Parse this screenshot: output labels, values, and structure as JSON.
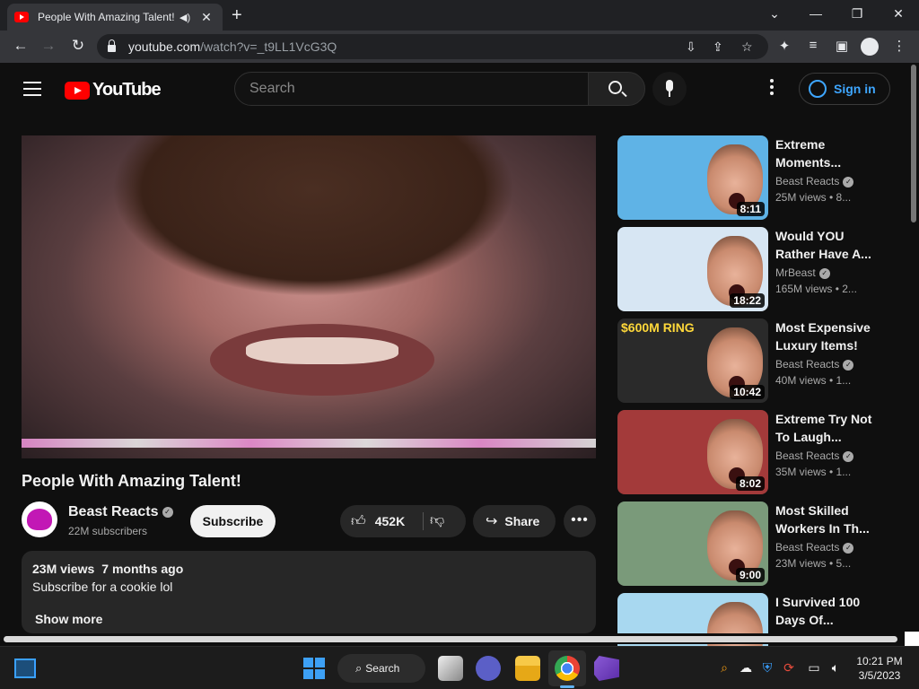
{
  "browser": {
    "tab_title": "People With Amazing Talent!",
    "speaker_icon": "speaker-icon",
    "close_glyph": "✕",
    "new_tab_glyph": "+",
    "window_controls": [
      "⌄",
      "—",
      "❐",
      "✕"
    ],
    "url_host": "youtube.com",
    "url_path": "/watch?v=_t9LL1VcG3Q"
  },
  "youtube": {
    "logo_text": "YouTube",
    "search_placeholder": "Search",
    "sign_in": "Sign in",
    "accent": "#3ea6ff",
    "brand_red": "#ff0000"
  },
  "video": {
    "title": "People With Amazing Talent!",
    "channel": "Beast Reacts",
    "subscribers": "22M subscribers",
    "subscribe_label": "Subscribe",
    "likes": "452K",
    "share_label": "Share",
    "more_glyph": "•••",
    "views": "23M views",
    "age": "7 months ago",
    "description": "Subscribe for a cookie lol",
    "show_more": "Show more"
  },
  "recommendations": [
    {
      "title": "Extreme Moments...",
      "channel": "Beast Reacts",
      "meta": "25M views • 8...",
      "duration": "8:11",
      "verified": true,
      "bg": "#5fb3e6"
    },
    {
      "title": "Would YOU Rather Have A...",
      "channel": "MrBeast",
      "meta": "165M views • 2...",
      "duration": "18:22",
      "verified": true,
      "bg": "#d7e6f3"
    },
    {
      "title": "Most Expensive Luxury Items!",
      "channel": "Beast Reacts",
      "meta": "40M views • 1...",
      "duration": "10:42",
      "verified": true,
      "bg": "#2a2a2a",
      "overlay": "$600M RING"
    },
    {
      "title": "Extreme Try Not To Laugh...",
      "channel": "Beast Reacts",
      "meta": "35M views • 1...",
      "duration": "8:02",
      "verified": true,
      "bg": "#a33a3a"
    },
    {
      "title": "Most Skilled Workers In Th...",
      "channel": "Beast Reacts",
      "meta": "23M views • 5...",
      "duration": "9:00",
      "verified": true,
      "bg": "#7a9a7a"
    },
    {
      "title": "I Survived 100 Days Of...",
      "channel": "",
      "meta": "",
      "duration": "",
      "verified": false,
      "bg": "#a8d8f0"
    }
  ],
  "taskbar": {
    "search_label": "Search",
    "time": "10:21 PM",
    "date": "3/5/2023"
  }
}
